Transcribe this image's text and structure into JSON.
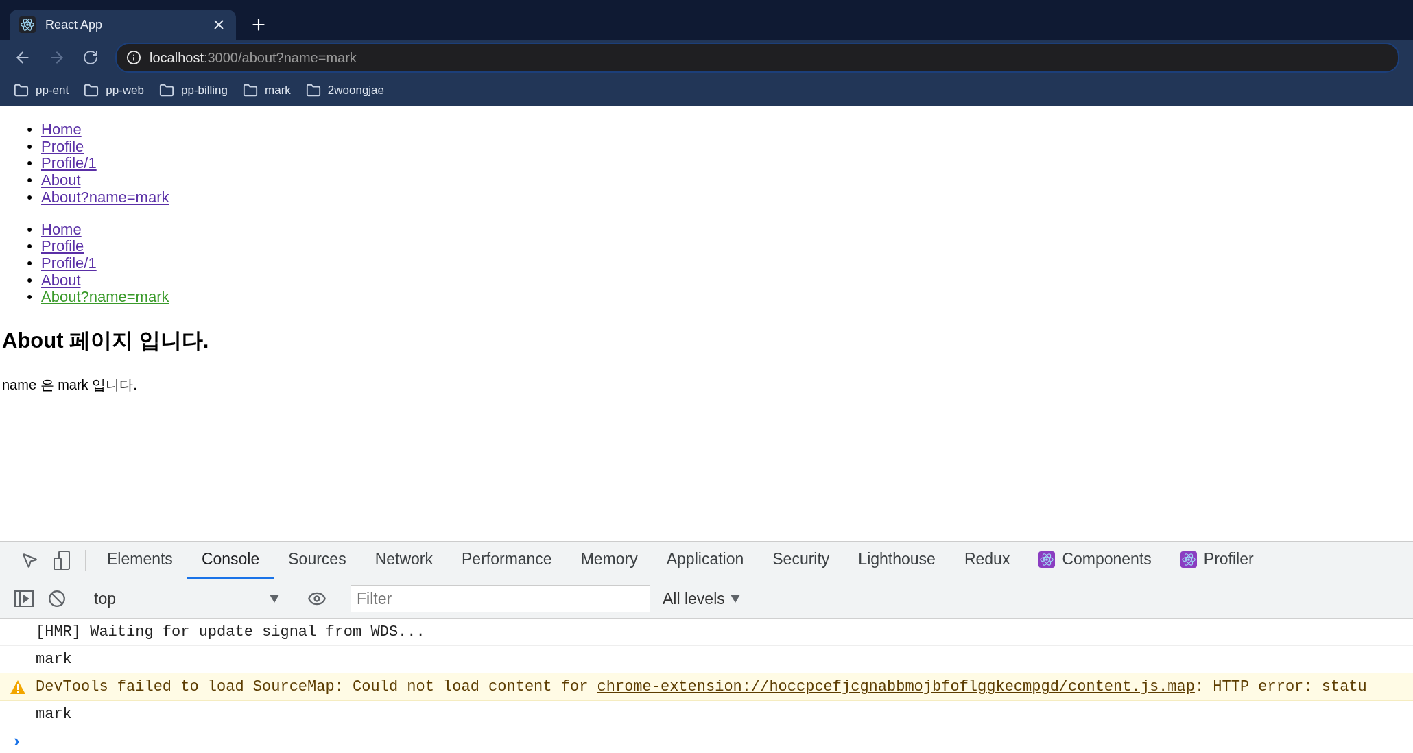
{
  "browser": {
    "tab": {
      "title": "React App"
    },
    "address": {
      "host": "localhost",
      "path": ":3000/about?name=mark"
    },
    "bookmarks": [
      "pp-ent",
      "pp-web",
      "pp-billing",
      "mark",
      "2woongjae"
    ]
  },
  "page": {
    "nav_lists": [
      [
        {
          "bullet": "•",
          "label": "Home",
          "selected": false
        },
        {
          "bullet": "•",
          "label": "Profile",
          "selected": false
        },
        {
          "bullet": "•",
          "label": "Profile/1",
          "selected": false
        },
        {
          "bullet": "•",
          "label": "About",
          "selected": false
        },
        {
          "bullet": "•",
          "label": "About?name=mark",
          "selected": false
        }
      ],
      [
        {
          "bullet": "•",
          "label": "Home",
          "selected": false
        },
        {
          "bullet": "•",
          "label": "Profile",
          "selected": false
        },
        {
          "bullet": "•",
          "label": "Profile/1",
          "selected": false
        },
        {
          "bullet": "•",
          "label": "About",
          "selected": false
        },
        {
          "bullet": "•",
          "label": "About?name=mark",
          "selected": true
        }
      ]
    ],
    "heading": "About 페이지 입니다.",
    "paragraph": "name 은 mark 입니다."
  },
  "devtools": {
    "tabs": [
      {
        "label": "Elements",
        "selected": false,
        "kind": "plain"
      },
      {
        "label": "Console",
        "selected": true,
        "kind": "plain"
      },
      {
        "label": "Sources",
        "selected": false,
        "kind": "plain"
      },
      {
        "label": "Network",
        "selected": false,
        "kind": "plain"
      },
      {
        "label": "Performance",
        "selected": false,
        "kind": "plain"
      },
      {
        "label": "Memory",
        "selected": false,
        "kind": "plain"
      },
      {
        "label": "Application",
        "selected": false,
        "kind": "plain"
      },
      {
        "label": "Security",
        "selected": false,
        "kind": "plain"
      },
      {
        "label": "Lighthouse",
        "selected": false,
        "kind": "plain"
      },
      {
        "label": "Redux",
        "selected": false,
        "kind": "plain"
      },
      {
        "label": "Components",
        "selected": false,
        "kind": "react"
      },
      {
        "label": "Profiler",
        "selected": false,
        "kind": "react"
      }
    ],
    "context": "top",
    "filter": {
      "placeholder": "Filter"
    },
    "levels": "All levels",
    "messages": [
      {
        "kind": "log",
        "text": "[HMR] Waiting for update signal from WDS..."
      },
      {
        "kind": "log",
        "text": "mark"
      },
      {
        "kind": "warning",
        "text": "DevTools failed to load SourceMap: Could not load content for ",
        "link": "chrome-extension://hoccpcefjcgnabbmojbfoflggkecmpgd/content.js.map",
        "rest": ": HTTP error: statu"
      },
      {
        "kind": "log",
        "text": "mark"
      }
    ],
    "prompt": "›"
  }
}
